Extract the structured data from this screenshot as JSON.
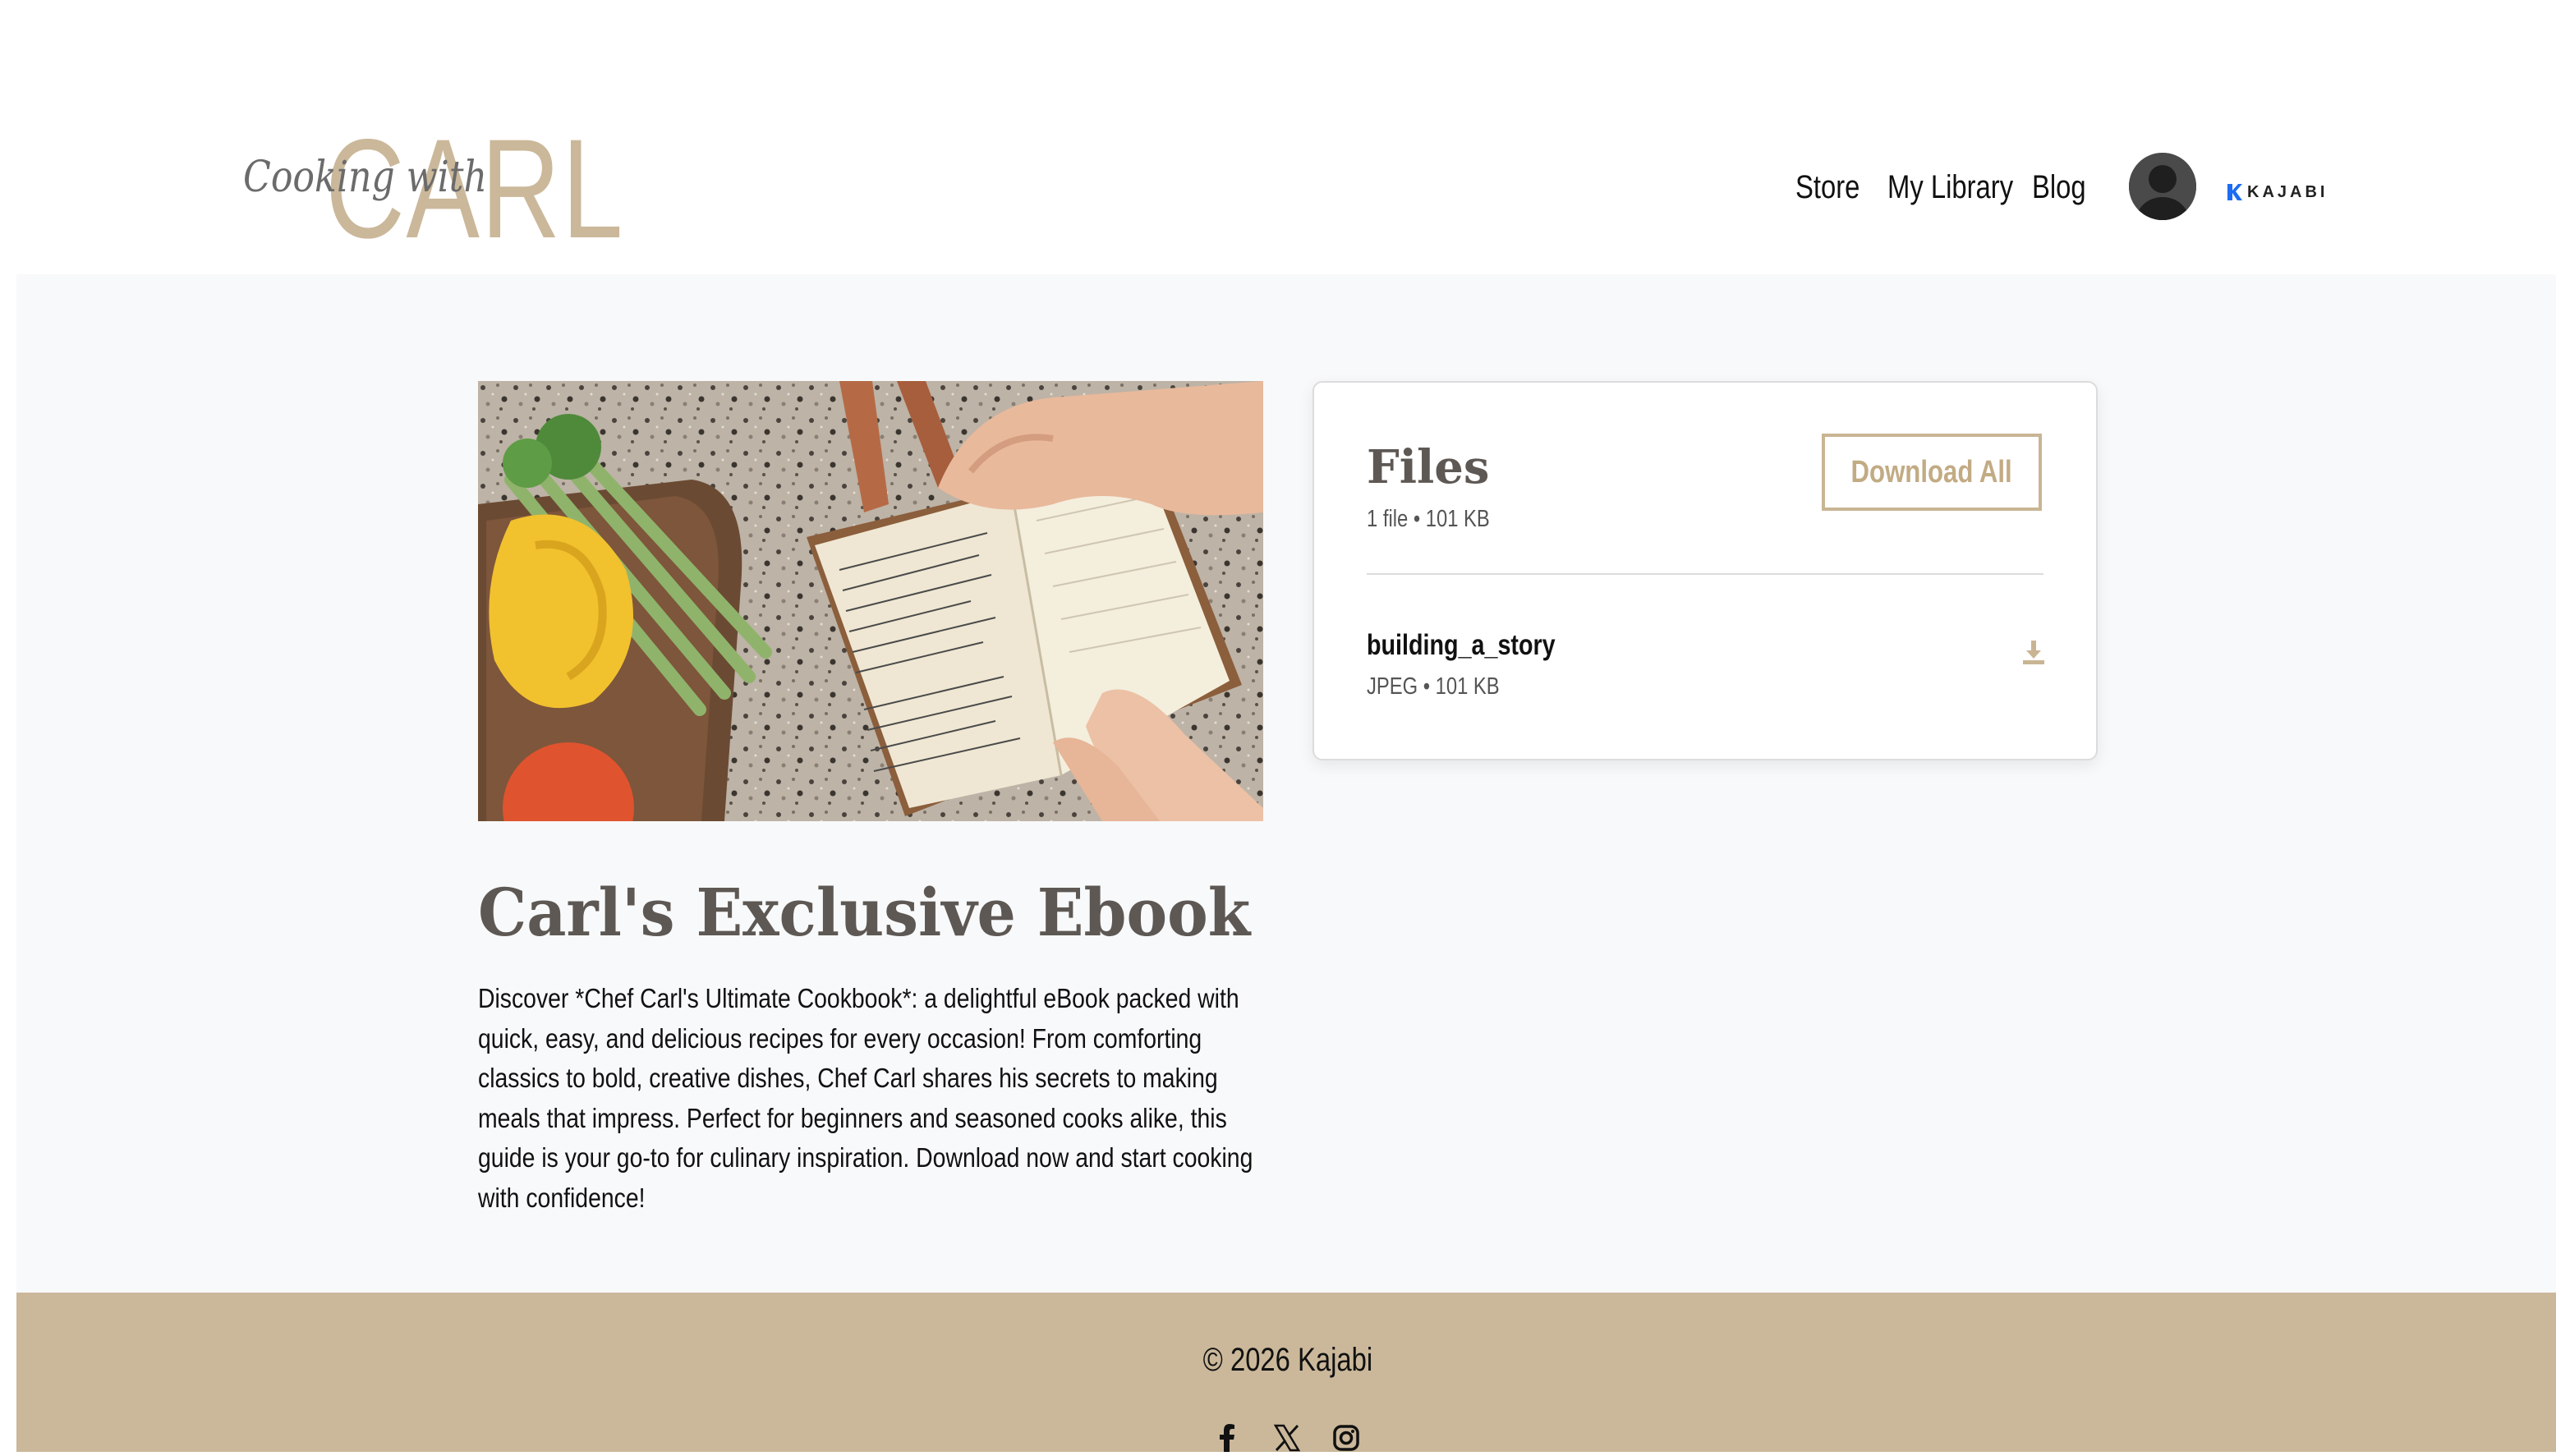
{
  "header": {
    "logo": {
      "script": "Cooking with",
      "main": "CARL"
    },
    "nav": [
      {
        "label": "Store"
      },
      {
        "label": "My Library"
      },
      {
        "label": "Blog"
      }
    ],
    "avatar_icon": "user-avatar-icon",
    "kajabi_label": "KAJABI"
  },
  "product": {
    "title": "Carl's Exclusive Ebook",
    "description": "Discover *Chef Carl's Ultimate Cookbook*: a delightful eBook packed with quick, easy, and delicious recipes for every occasion! From comforting classics to bold, creative dishes, Chef Carl shares his secrets to making meals that impress. Perfect for beginners and seasoned cooks alike, this guide is your go-to for culinary inspiration. Download now and start cooking with confidence!"
  },
  "files_panel": {
    "title": "Files",
    "meta": "1 file • 101 KB",
    "download_all_label": "Download All",
    "files": [
      {
        "name": "building_a_story",
        "meta": "JPEG • 101 KB",
        "icon": "download-icon"
      }
    ]
  },
  "footer": {
    "copyright": "© 2026 Kajabi",
    "social_icons": [
      "facebook-icon",
      "x-icon",
      "instagram-icon"
    ]
  },
  "colors": {
    "accent": "#cbb89a",
    "button_text": "#c2ab84",
    "heading": "#5e5854",
    "page_bg": "#f8f9fa"
  }
}
